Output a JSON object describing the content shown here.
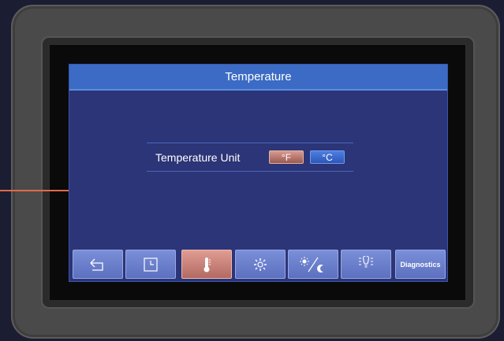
{
  "screen": {
    "title": "Temperature"
  },
  "temperature_unit": {
    "label": "Temperature Unit",
    "options": [
      {
        "label": "°F",
        "selected": true
      },
      {
        "label": "°C",
        "selected": false
      }
    ]
  },
  "navbar": {
    "items": [
      {
        "icon": "back-arrow-icon"
      },
      {
        "icon": "clock-icon"
      },
      {
        "icon": "thermometer-icon",
        "active": true
      },
      {
        "icon": "fan-icon"
      },
      {
        "icon": "day-night-icon"
      },
      {
        "icon": "light-bulb-icon"
      },
      {
        "label": "Diagnostics"
      }
    ]
  },
  "colors": {
    "accent": "#3b6bc4",
    "background": "#2b3577",
    "active": "#c57c73",
    "callout": "#e06a4a"
  }
}
